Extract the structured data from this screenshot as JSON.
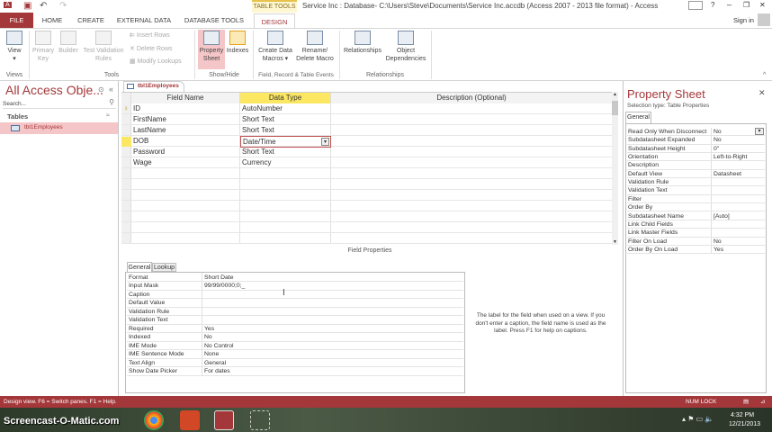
{
  "window": {
    "title": "Service Inc : Database- C:\\Users\\Steve\\Documents\\Service Inc.accdb (Access 2007 - 2013 file format) - Access",
    "context_tab": "TABLE TOOLS",
    "sign_in": "Sign in",
    "help": "?",
    "minimize": "–",
    "restore": "❐",
    "close": "✕"
  },
  "tabs": [
    "FILE",
    "HOME",
    "CREATE",
    "EXTERNAL DATA",
    "DATABASE TOOLS",
    "DESIGN"
  ],
  "ribbon": {
    "view": "View",
    "primary_key": "Primary Key",
    "builder": "Builder",
    "test_validation": "Test Validation Rules",
    "insert_rows": "Insert Rows",
    "delete_rows": "Delete Rows",
    "modify_lookups": "Modify Lookups",
    "property_sheet": "Property Sheet",
    "indexes": "Indexes",
    "create_data_macros": "Create Data Macros ▾",
    "rename_delete_macro": "Rename/ Delete Macro",
    "relationships": "Relationships",
    "object_dependencies": "Object Dependencies",
    "groups": {
      "views": "Views",
      "tools": "Tools",
      "show_hide": "Show/Hide",
      "events": "Field, Record & Table Events",
      "relationships": "Relationships"
    }
  },
  "nav": {
    "title": "All Access Obje...",
    "search_placeholder": "Search...",
    "section": "Tables",
    "items": [
      "tbl1Employees"
    ]
  },
  "doc": {
    "tab": "tbl1Employees",
    "headers": [
      "Field Name",
      "Data Type",
      "Description (Optional)"
    ],
    "rows": [
      {
        "name": "ID",
        "type": "AutoNumber"
      },
      {
        "name": "FirstName",
        "type": "Short Text"
      },
      {
        "name": "LastName",
        "type": "Short Text"
      },
      {
        "name": "DOB",
        "type": "Date/Time"
      },
      {
        "name": "Password",
        "type": "Short Text"
      },
      {
        "name": "Wage",
        "type": "Currency"
      }
    ],
    "field_properties_label": "Field Properties",
    "fp_tabs": [
      "General",
      "Lookup"
    ],
    "field_properties": [
      [
        "Format",
        "Short Date"
      ],
      [
        "Input Mask",
        "99/99/0000;0;_"
      ],
      [
        "Caption",
        ""
      ],
      [
        "Default Value",
        ""
      ],
      [
        "Validation Rule",
        ""
      ],
      [
        "Validation Text",
        ""
      ],
      [
        "Required",
        "Yes"
      ],
      [
        "Indexed",
        "No"
      ],
      [
        "IME Mode",
        "No Control"
      ],
      [
        "IME Sentence Mode",
        "None"
      ],
      [
        "Text Align",
        "General"
      ],
      [
        "Show Date Picker",
        "For dates"
      ]
    ],
    "help_text": "The label for the field when used on a view. If you don't enter a caption, the field name is used as the label. Press F1 for help on captions."
  },
  "property_sheet": {
    "title": "Property Sheet",
    "selection_type": "Selection type:  Table Properties",
    "tab": "General",
    "rows": [
      [
        "Read Only When Disconnect",
        "No"
      ],
      [
        "Subdatasheet Expanded",
        "No"
      ],
      [
        "Subdatasheet Height",
        "0\""
      ],
      [
        "Orientation",
        "Left-to-Right"
      ],
      [
        "Description",
        ""
      ],
      [
        "Default View",
        "Datasheet"
      ],
      [
        "Validation Rule",
        ""
      ],
      [
        "Validation Text",
        ""
      ],
      [
        "Filter",
        ""
      ],
      [
        "Order By",
        ""
      ],
      [
        "Subdatasheet Name",
        "[Auto]"
      ],
      [
        "Link Child Fields",
        ""
      ],
      [
        "Link Master Fields",
        ""
      ],
      [
        "Filter On Load",
        "No"
      ],
      [
        "Order By On Load",
        "Yes"
      ]
    ]
  },
  "status": {
    "text": "Design view.  F6 = Switch panes.  F1 = Help.",
    "num_lock": "NUM LOCK"
  },
  "taskbar": {
    "watermark": "Screencast-O-Matic.com",
    "time": "4:32 PM",
    "date": "12/21/2013"
  },
  "colors": {
    "accent": "#a4373a",
    "selection": "#f5c6c8",
    "header_yellow": "#fce762"
  }
}
